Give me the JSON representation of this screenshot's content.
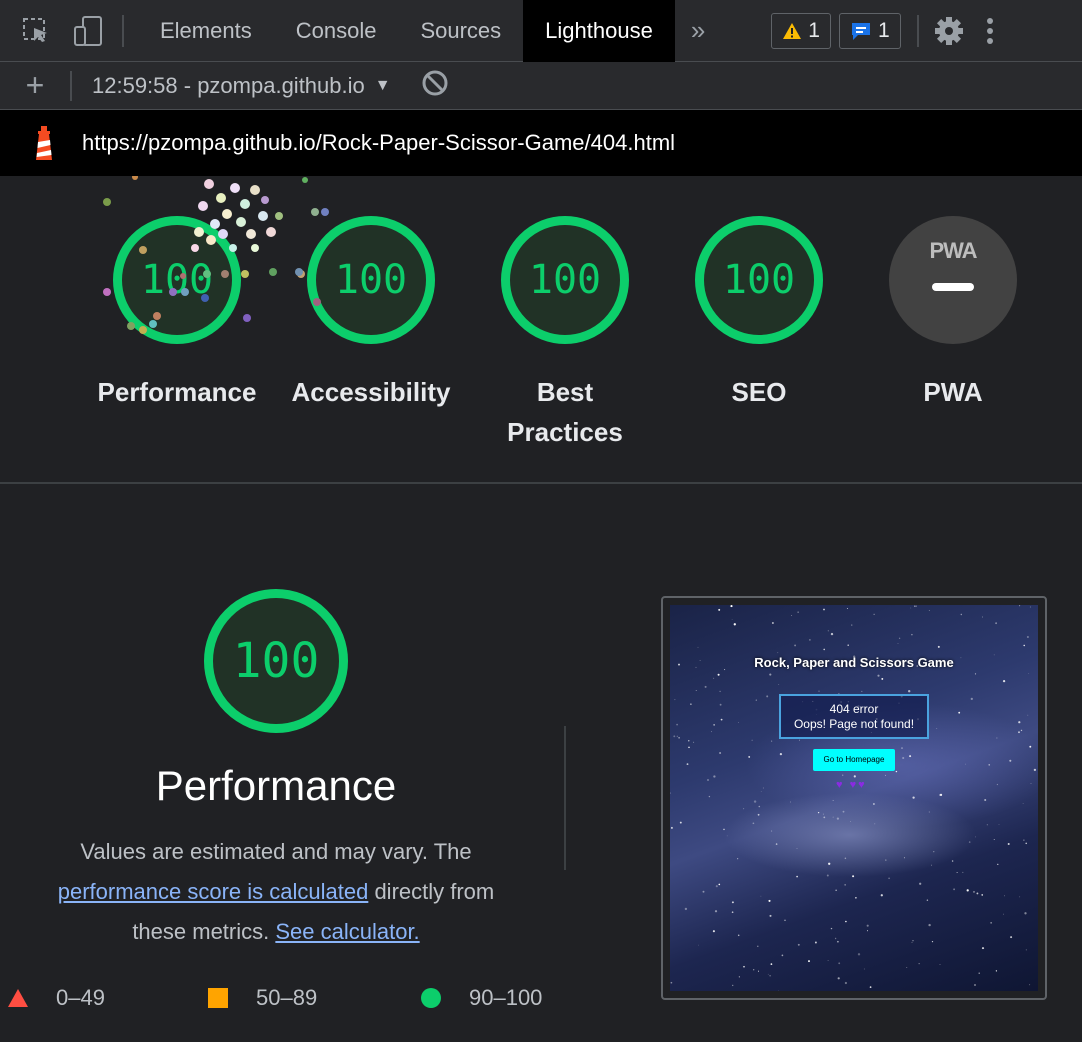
{
  "devtools": {
    "tabs": [
      {
        "label": "Elements"
      },
      {
        "label": "Console"
      },
      {
        "label": "Sources"
      },
      {
        "label": "Lighthouse"
      }
    ],
    "more_tabs_glyph": "»",
    "warnings_count": "1",
    "messages_count": "1",
    "icons": {
      "inspect": "inspect-element-icon",
      "device": "device-toolbar-icon",
      "warning": "warning-icon",
      "message": "message-icon",
      "settings": "gear-icon",
      "menu": "kebab-menu-icon"
    }
  },
  "toolbar": {
    "new_report": "+",
    "report_select": "12:59:58 - pzompa.github.io",
    "clear_icon": "block-icon"
  },
  "report": {
    "url": "https://pzompa.github.io/Rock-Paper-Scissor-Game/404.html",
    "gauges": [
      {
        "score": "100",
        "label": "Performance"
      },
      {
        "score": "100",
        "label": "Accessibility"
      },
      {
        "score": "100",
        "label": "Best Practices"
      },
      {
        "score": "100",
        "label": "SEO"
      },
      {
        "badge": "PWA",
        "label": "PWA"
      }
    ],
    "performance": {
      "score": "100",
      "title": "Performance",
      "desc_prefix": "Values are estimated and may vary. The ",
      "desc_link": "performance score is calculated",
      "desc_middle": " directly from these metrics. ",
      "desc_calc_link": "See calculator."
    },
    "legend": [
      {
        "range": "0–49",
        "color": "#ff4e42",
        "shape": "triangle"
      },
      {
        "range": "50–89",
        "color": "#ffa400",
        "shape": "square"
      },
      {
        "range": "90–100",
        "color": "#0cce6b",
        "shape": "circle"
      }
    ],
    "colors": {
      "pass": "#0cce6b"
    },
    "screenshot": {
      "title": "Rock, Paper and Scissors Game",
      "error_line1": "404 error",
      "error_line2": "Oops! Page not found!",
      "button": "Go to Homepage",
      "hearts": "♥ ♥♥"
    }
  }
}
